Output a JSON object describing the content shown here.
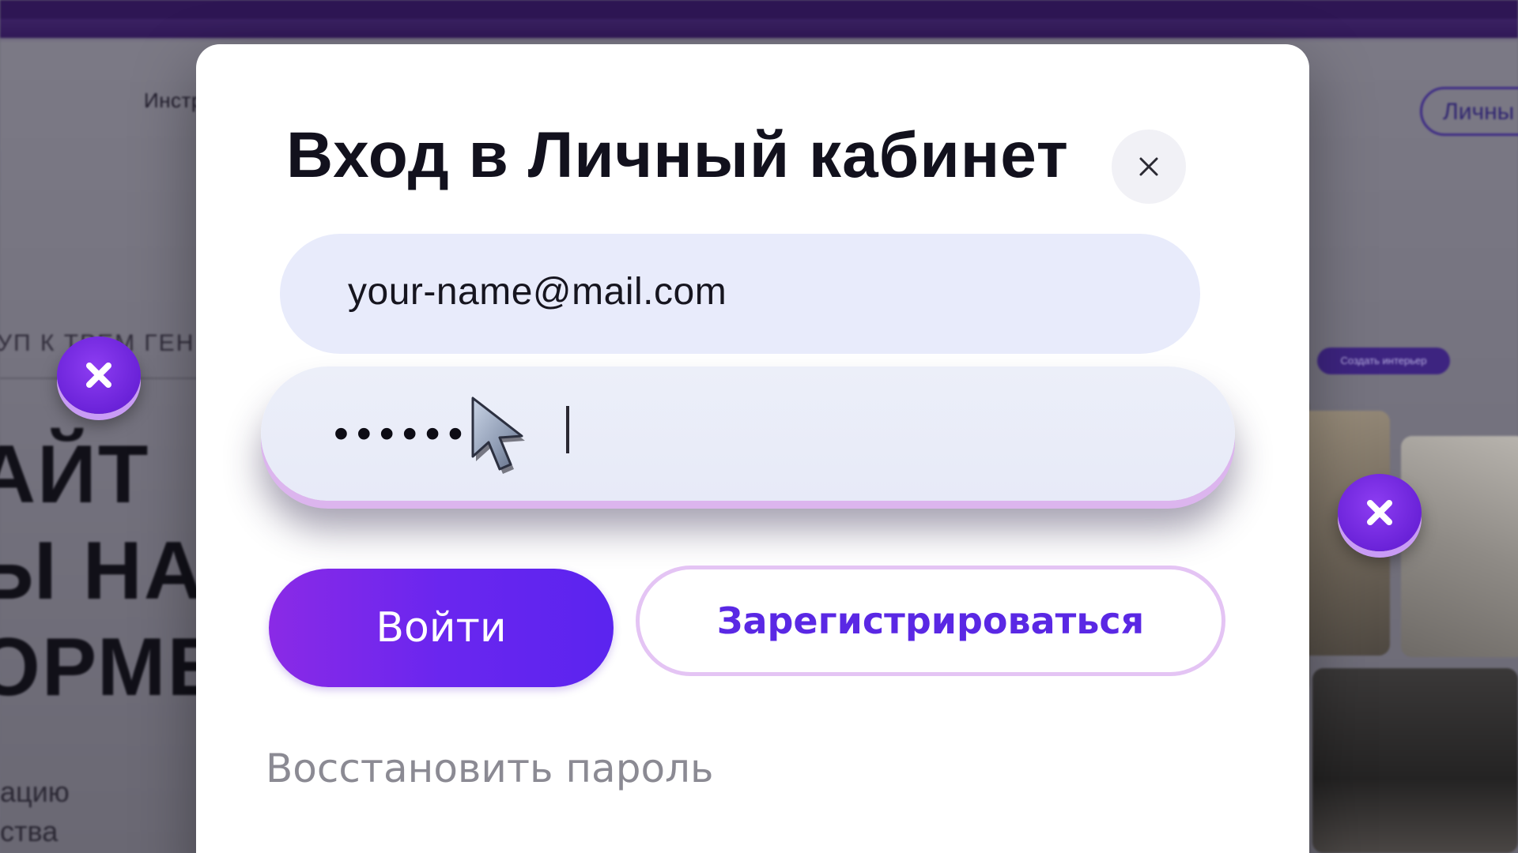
{
  "background": {
    "nav_text": "Инстр",
    "cabinet_button": "Личны",
    "access_text": "УП К ТРЕМ ГЕН",
    "hero_text": "АЙТ\nЫ НА\nОРМЕ",
    "small_text": "ацию\nства",
    "create_button": "Создать интерьер"
  },
  "modal": {
    "title": "Вход в Личный кабинет",
    "close_icon": "close-icon",
    "email_value": "your-name@mail.com",
    "password_masked": "•••••••",
    "login_label": "Войти",
    "register_label": "Зарегистрироваться",
    "restore_label": "Восстановить пароль"
  },
  "colors": {
    "accent": "#6a26ef",
    "accent_gradient_start": "#8a2ae6",
    "field_bg": "#e8ebfb",
    "register_border": "#e4c4f4",
    "badge": "#7a2fe8",
    "topbar": "#2e1654"
  },
  "icons": {
    "badges": "close-x-badge-icon",
    "pointer": "mouse-pointer-icon"
  }
}
